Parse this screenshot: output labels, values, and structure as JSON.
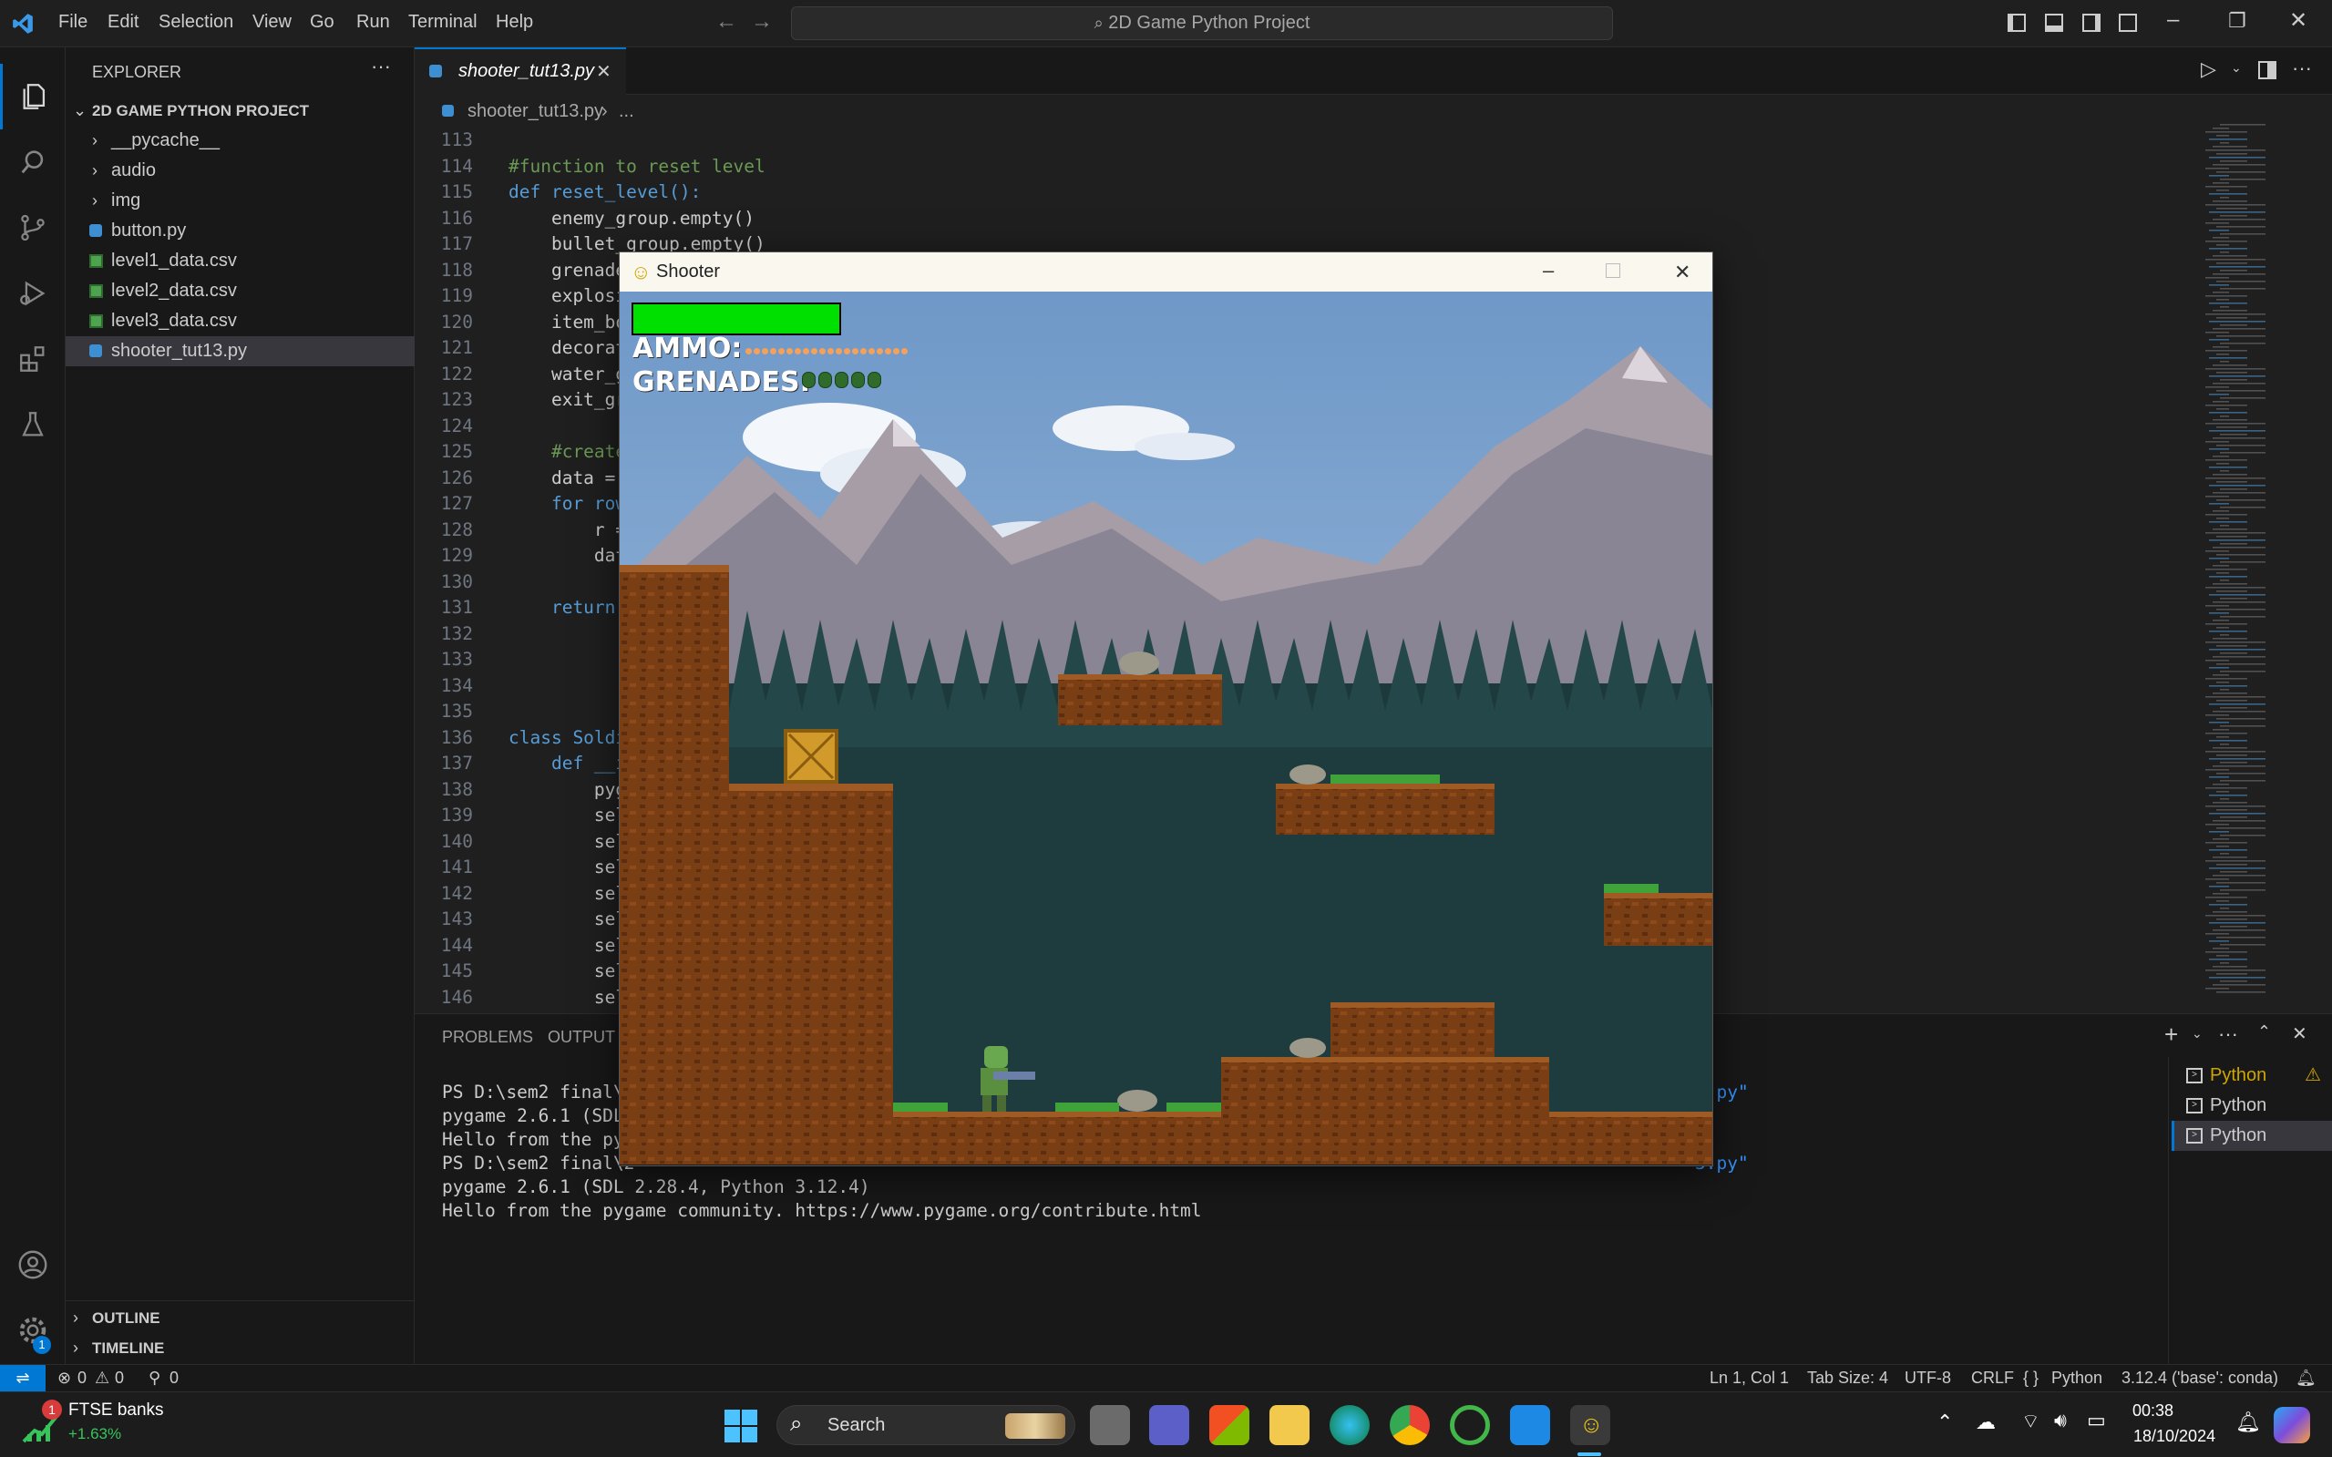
{
  "titlebar": {
    "menu": [
      "File",
      "Edit",
      "Selection",
      "View",
      "Go",
      "Run",
      "Terminal",
      "Help"
    ],
    "command_center": "2D Game Python Project"
  },
  "sidebar": {
    "title": "EXPLORER",
    "project": "2D GAME PYTHON PROJECT",
    "items": [
      {
        "label": "__pycache__",
        "type": "folder"
      },
      {
        "label": "audio",
        "type": "folder"
      },
      {
        "label": "img",
        "type": "folder"
      },
      {
        "label": "button.py",
        "type": "python"
      },
      {
        "label": "level1_data.csv",
        "type": "csv"
      },
      {
        "label": "level2_data.csv",
        "type": "csv"
      },
      {
        "label": "level3_data.csv",
        "type": "csv"
      },
      {
        "label": "shooter_tut13.py",
        "type": "python",
        "selected": true
      }
    ],
    "outline": "OUTLINE",
    "timeline": "TIMELINE"
  },
  "editor": {
    "tab": "shooter_tut13.py",
    "breadcrumb_file": "shooter_tut13.py",
    "breadcrumb_more": "...",
    "lines": [
      {
        "n": "113",
        "text": ""
      },
      {
        "n": "114",
        "text": "#function to reset level"
      },
      {
        "n": "115",
        "text": "def reset_level():"
      },
      {
        "n": "116",
        "text": "    enemy_group.empty()"
      },
      {
        "n": "117",
        "text": "    bullet_group.empty()"
      },
      {
        "n": "118",
        "text": "    grenade"
      },
      {
        "n": "119",
        "text": "    explosi"
      },
      {
        "n": "120",
        "text": "    item_bo"
      },
      {
        "n": "121",
        "text": "    decorat"
      },
      {
        "n": "122",
        "text": "    water_g"
      },
      {
        "n": "123",
        "text": "    exit_gr"
      },
      {
        "n": "124",
        "text": ""
      },
      {
        "n": "125",
        "text": "    #create"
      },
      {
        "n": "126",
        "text": "    data = "
      },
      {
        "n": "127",
        "text": "    for row"
      },
      {
        "n": "128",
        "text": "        r = "
      },
      {
        "n": "129",
        "text": "        dat"
      },
      {
        "n": "130",
        "text": ""
      },
      {
        "n": "131",
        "text": "    return "
      },
      {
        "n": "132",
        "text": ""
      },
      {
        "n": "133",
        "text": ""
      },
      {
        "n": "134",
        "text": ""
      },
      {
        "n": "135",
        "text": ""
      },
      {
        "n": "136",
        "text": "class Soldi"
      },
      {
        "n": "137",
        "text": "    def __i"
      },
      {
        "n": "138",
        "text": "        pyg"
      },
      {
        "n": "139",
        "text": "        sel"
      },
      {
        "n": "140",
        "text": "        sel"
      },
      {
        "n": "141",
        "text": "        sel"
      },
      {
        "n": "142",
        "text": "        sel"
      },
      {
        "n": "143",
        "text": "        sel"
      },
      {
        "n": "144",
        "text": "        sel"
      },
      {
        "n": "145",
        "text": "        sel"
      },
      {
        "n": "146",
        "text": "        sel"
      }
    ]
  },
  "panel": {
    "tabs": [
      "PROBLEMS",
      "OUTPUT"
    ],
    "terminal_lines": [
      "PS D:\\sem2 final\\2",
      "pygame 2.6.1 (SDL ",
      "Hello from the pyg",
      "PS D:\\sem2 final\\2",
      "pygame 2.6.1 (SDL 2.28.4, Python 3.12.4)",
      "Hello from the pygame community. https://www.pygame.org/contribute.html"
    ],
    "terminal_tail_1": "3.py\"",
    "terminal_tail_2": "3.py\"",
    "terminals": [
      "Python",
      "Python",
      "Python"
    ]
  },
  "statusbar": {
    "errors": "0",
    "warnings": "0",
    "ports": "0",
    "position": "Ln 1, Col 1",
    "tab_size": "Tab Size: 4",
    "encoding": "UTF-8",
    "eol": "CRLF",
    "language": "Python",
    "interpreter": "3.12.4 ('base': conda)"
  },
  "game": {
    "title": "Shooter",
    "ammo_label": "AMMO:",
    "grenades_label": "GRENADES:",
    "ammo_count": 20,
    "grenade_count": 5,
    "health_fraction": 1.0
  },
  "taskbar": {
    "stock_name": "FTSE banks",
    "stock_change": "+1.63%",
    "stock_badge": "1",
    "search": "Search",
    "time": "00:38",
    "date": "18/10/2024"
  },
  "colors": {
    "accent": "#0078d4",
    "health": "#00e000",
    "sky": "#6f98c8",
    "dirt": "#7a3e15"
  }
}
